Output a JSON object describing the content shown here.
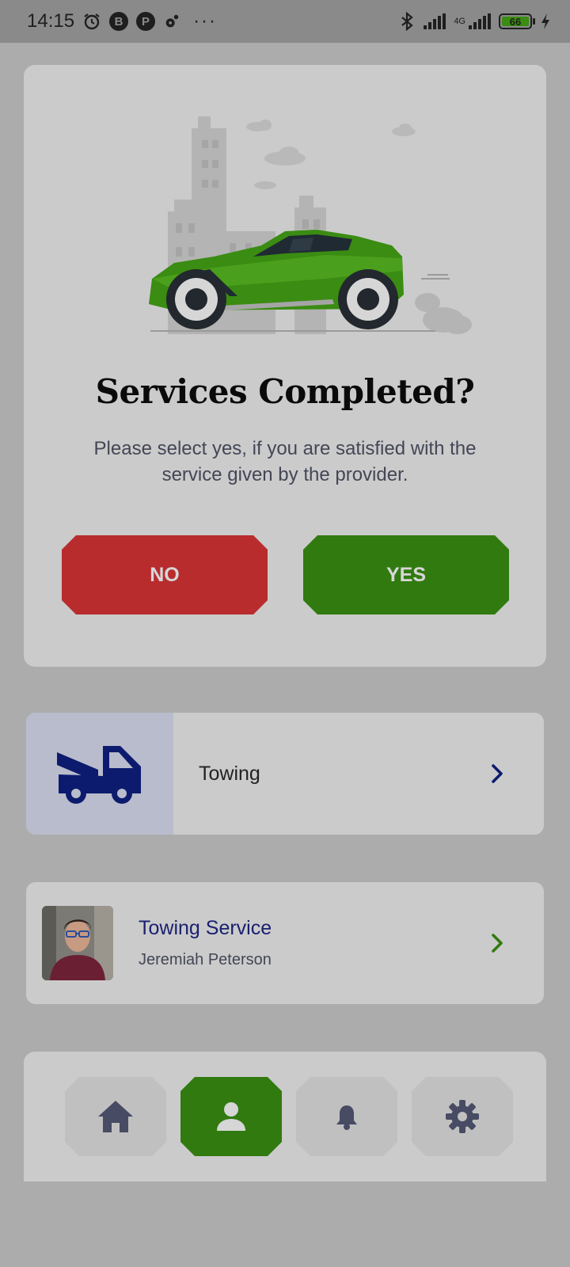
{
  "status_bar": {
    "time": "14:15",
    "network_type": "4G",
    "battery_level": "66",
    "overflow": "···",
    "icons": [
      "alarm-icon",
      "b-app-icon",
      "p-app-icon",
      "settings-small-icon",
      "bluetooth-icon",
      "signal-icon",
      "charging-icon"
    ]
  },
  "dialog": {
    "illustration": "green-sports-car-city-illustration",
    "title": "Services Completed?",
    "message": "Please select yes, if you are satisfied with the service given by the provider.",
    "no_label": "NO",
    "yes_label": "YES"
  },
  "service": {
    "icon": "tow-truck-icon",
    "label": "Towing"
  },
  "provider": {
    "title": "Towing Service",
    "name": "Jeremiah Peterson"
  },
  "bottom_nav": {
    "items": [
      {
        "icon": "home-icon",
        "active": false
      },
      {
        "icon": "profile-icon",
        "active": true
      },
      {
        "icon": "bell-icon",
        "active": false
      },
      {
        "icon": "gear-icon",
        "active": false
      }
    ]
  },
  "colors": {
    "no_button": "#b82c2e",
    "yes_button": "#317a10",
    "accent_navy": "#0d1b6e",
    "card": "#cbcbcb",
    "backdrop": "#acacac"
  }
}
